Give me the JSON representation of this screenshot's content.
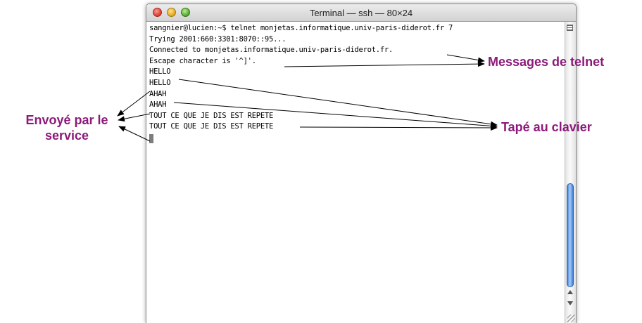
{
  "window": {
    "title": "Terminal — ssh — 80×24"
  },
  "terminal": {
    "lines": [
      "sangnier@lucien:~$ telnet monjetas.informatique.univ-paris-diderot.fr 7",
      "Trying 2001:660:3301:8070::95...",
      "Connected to monjetas.informatique.univ-paris-diderot.fr.",
      "Escape character is '^]'.",
      "HELLO",
      "HELLO",
      "AHAH",
      "AHAH",
      "TOUT CE QUE JE DIS EST REPETE",
      "TOUT CE QUE JE DIS EST REPETE"
    ]
  },
  "annotations": {
    "messages_telnet": "Messages de telnet",
    "tape_au_clavier": "Tapé au clavier",
    "envoye_line1": "Envoyé par le",
    "envoye_line2": "service"
  },
  "colors": {
    "annotation": "#8c1a7a",
    "scroll_thumb": "#3f7fd8"
  }
}
